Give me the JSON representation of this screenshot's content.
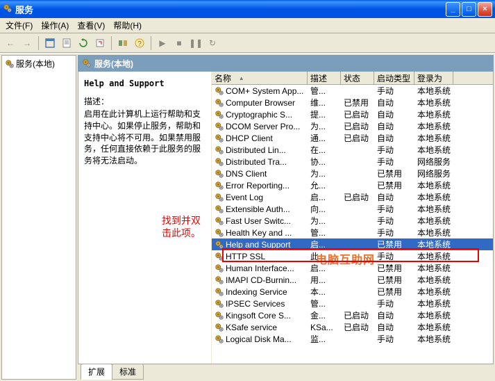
{
  "window": {
    "title": "服务",
    "min": "_",
    "max": "□",
    "close": "×"
  },
  "menu": {
    "file": "文件(F)",
    "action": "操作(A)",
    "view": "查看(V)",
    "help": "帮助(H)"
  },
  "tree": {
    "root": "服务(本地)"
  },
  "panel": {
    "header": "服务(本地)"
  },
  "detail": {
    "title": "Help and Support",
    "desc_label": "描述：",
    "desc_text": "启用在此计算机上运行帮助和支持中心。如果停止服务，帮助和支持中心将不可用。如果禁用服务，任何直接依赖于此服务的服务将无法启动。"
  },
  "columns": {
    "name": "名称",
    "desc": "描述",
    "status": "状态",
    "startup": "启动类型",
    "login": "登录为"
  },
  "sort_arrow": "▲",
  "rows": [
    {
      "name": "COM+ System App...",
      "desc": "管...",
      "status": "",
      "startup": "手动",
      "login": "本地系统"
    },
    {
      "name": "Computer Browser",
      "desc": "维...",
      "status": "已禁用",
      "startup": "自动",
      "login": "本地系统"
    },
    {
      "name": "Cryptographic S...",
      "desc": "提...",
      "status": "已启动",
      "startup": "自动",
      "login": "本地系统"
    },
    {
      "name": "DCOM Server Pro...",
      "desc": "为...",
      "status": "已启动",
      "startup": "自动",
      "login": "本地系统"
    },
    {
      "name": "DHCP Client",
      "desc": "通...",
      "status": "已启动",
      "startup": "自动",
      "login": "本地系统"
    },
    {
      "name": "Distributed Lin...",
      "desc": "在...",
      "status": "",
      "startup": "手动",
      "login": "本地系统"
    },
    {
      "name": "Distributed Tra...",
      "desc": "协...",
      "status": "",
      "startup": "手动",
      "login": "网络服务"
    },
    {
      "name": "DNS Client",
      "desc": "为...",
      "status": "",
      "startup": "已禁用",
      "login": "网络服务"
    },
    {
      "name": "Error Reporting...",
      "desc": "允...",
      "status": "",
      "startup": "已禁用",
      "login": "本地系统"
    },
    {
      "name": "Event Log",
      "desc": "启...",
      "status": "已启动",
      "startup": "自动",
      "login": "本地系统"
    },
    {
      "name": "Extensible Auth...",
      "desc": "向...",
      "status": "",
      "startup": "手动",
      "login": "本地系统"
    },
    {
      "name": "Fast User Switc...",
      "desc": "为...",
      "status": "",
      "startup": "手动",
      "login": "本地系统"
    },
    {
      "name": "Health Key and ...",
      "desc": "管...",
      "status": "",
      "startup": "手动",
      "login": "本地系统"
    },
    {
      "name": "Help and Support",
      "desc": "启...",
      "status": "",
      "startup": "已禁用",
      "login": "本地系统",
      "selected": true
    },
    {
      "name": "HTTP SSL",
      "desc": "此...",
      "status": "",
      "startup": "手动",
      "login": "本地系统"
    },
    {
      "name": "Human Interface...",
      "desc": "启...",
      "status": "",
      "startup": "已禁用",
      "login": "本地系统"
    },
    {
      "name": "IMAPI CD-Burnin...",
      "desc": "用...",
      "status": "",
      "startup": "已禁用",
      "login": "本地系统"
    },
    {
      "name": "Indexing Service",
      "desc": "本...",
      "status": "",
      "startup": "已禁用",
      "login": "本地系统"
    },
    {
      "name": "IPSEC Services",
      "desc": "管...",
      "status": "",
      "startup": "手动",
      "login": "本地系统"
    },
    {
      "name": "Kingsoft Core S...",
      "desc": "金...",
      "status": "已启动",
      "startup": "自动",
      "login": "本地系统"
    },
    {
      "name": "KSafe service",
      "desc": "KSa...",
      "status": "已启动",
      "startup": "自动",
      "login": "本地系统"
    },
    {
      "name": "Logical Disk Ma...",
      "desc": "监...",
      "status": "",
      "startup": "手动",
      "login": "本地系统"
    }
  ],
  "tabs": {
    "extended": "扩展",
    "standard": "标准"
  },
  "annotation": {
    "line1": "找到并双",
    "line2": "击此项。"
  },
  "watermark": "电脑互助网"
}
